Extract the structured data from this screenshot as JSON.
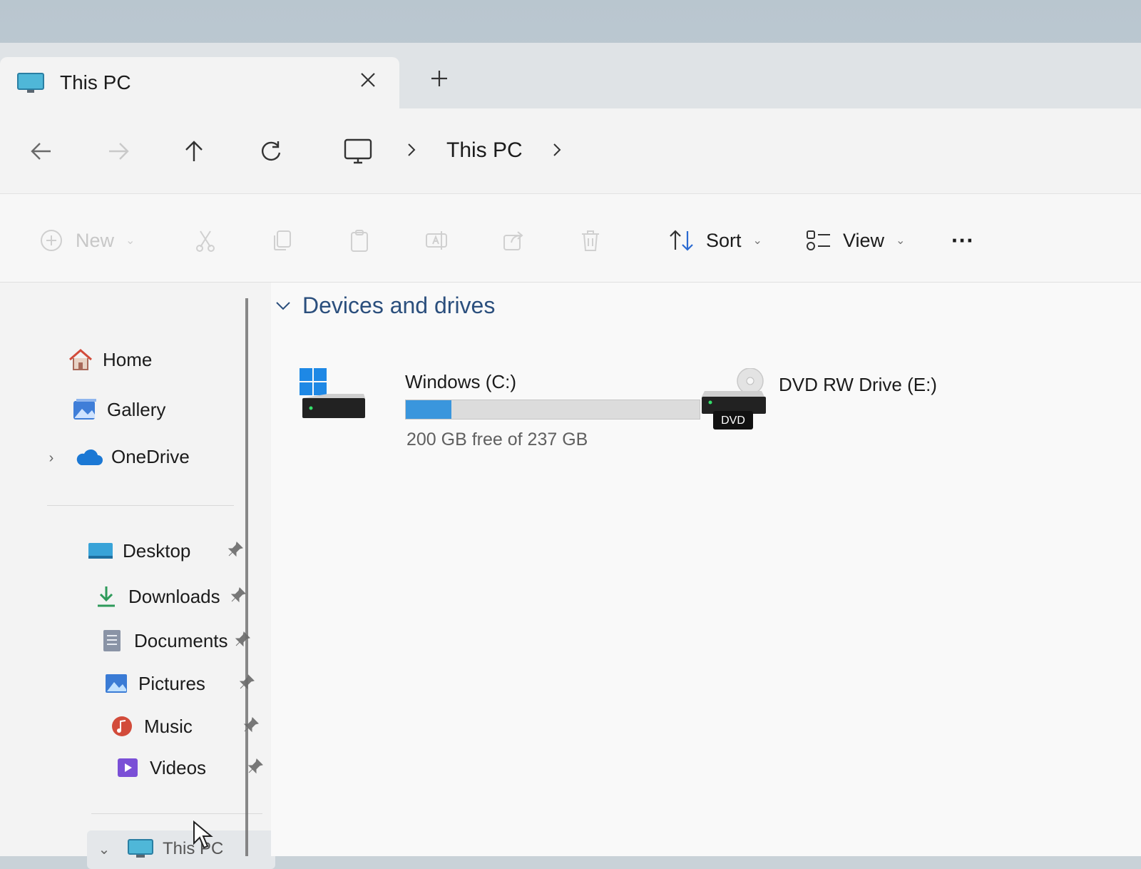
{
  "window": {
    "tab_title": "This PC",
    "new_tab_label": "+"
  },
  "address": {
    "crumb": "This PC"
  },
  "commands": {
    "new_label": "New",
    "sort_label": "Sort",
    "view_label": "View",
    "more_label": "···"
  },
  "sidebar": {
    "top_items": [
      {
        "label": "Home",
        "icon": "home-icon"
      },
      {
        "label": "Gallery",
        "icon": "gallery-icon"
      },
      {
        "label": "OneDrive",
        "icon": "cloud-icon"
      }
    ],
    "pinned": [
      {
        "label": "Desktop",
        "icon": "desktop-folder-icon"
      },
      {
        "label": "Downloads",
        "icon": "download-icon"
      },
      {
        "label": "Documents",
        "icon": "documents-icon"
      },
      {
        "label": "Pictures",
        "icon": "pictures-icon"
      },
      {
        "label": "Music",
        "icon": "music-icon"
      },
      {
        "label": "Videos",
        "icon": "videos-icon"
      }
    ],
    "this_pc_label": "This PC"
  },
  "content": {
    "section_title": "Devices and drives",
    "drives": [
      {
        "name": "Windows  (C:)",
        "free_text": "200 GB free of 237 GB",
        "used_fraction": 0.156
      },
      {
        "name": "DVD RW Drive (E:)",
        "badge": "DVD"
      }
    ]
  },
  "colors": {
    "accent": "#3a96dd",
    "section_title": "#2b4f7d"
  }
}
